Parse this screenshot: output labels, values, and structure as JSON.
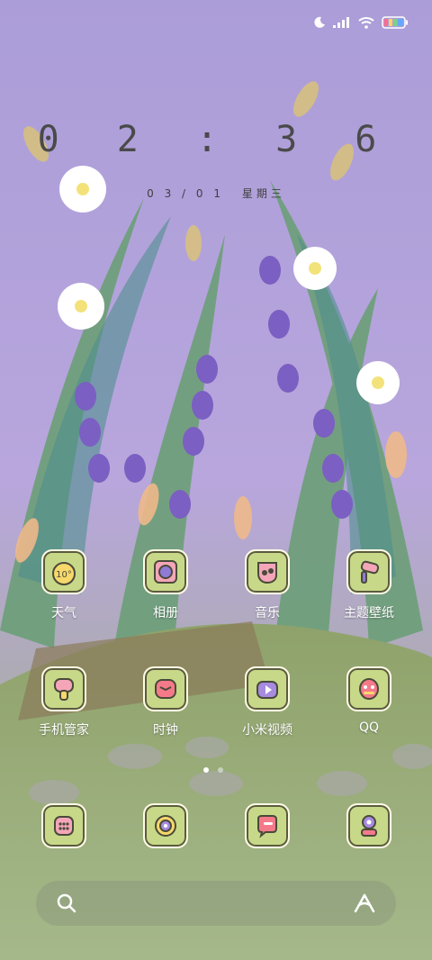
{
  "status": {
    "icons": [
      "moon-icon",
      "signal-icon",
      "wifi-icon",
      "battery-icon"
    ]
  },
  "clock": {
    "time": "0 2 : 3 6",
    "date": "0 3 / 0 1",
    "weekday": "星期三"
  },
  "apps": [
    {
      "label": "天气",
      "icon": "weather-icon",
      "badge": "10°"
    },
    {
      "label": "相册",
      "icon": "gallery-icon"
    },
    {
      "label": "音乐",
      "icon": "music-icon"
    },
    {
      "label": "主题壁纸",
      "icon": "theme-icon"
    },
    {
      "label": "手机管家",
      "icon": "security-icon"
    },
    {
      "label": "时钟",
      "icon": "clock-icon"
    },
    {
      "label": "小米视频",
      "icon": "video-icon"
    },
    {
      "label": "QQ",
      "icon": "qq-icon"
    }
  ],
  "dock": [
    {
      "icon": "phone-icon"
    },
    {
      "icon": "browser-icon"
    },
    {
      "icon": "messages-icon"
    },
    {
      "icon": "camera-icon"
    }
  ],
  "page_indicator": {
    "pages": 2,
    "current": 1
  },
  "search": {
    "left_icon": "search-icon",
    "right_icon": "assistant-icon"
  },
  "colors": {
    "sky": "#a99bd6",
    "grass": "#8aa36a",
    "icon_bg": "#c7d989"
  }
}
